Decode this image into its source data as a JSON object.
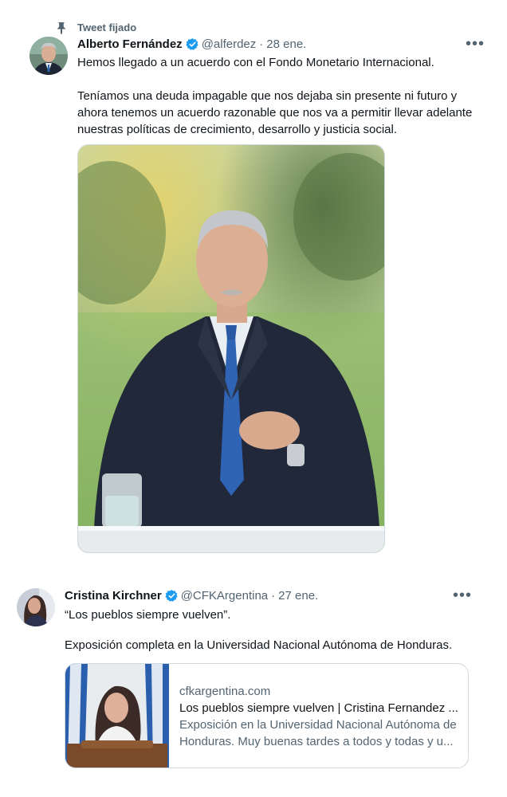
{
  "pinned": {
    "label": "Tweet fijado"
  },
  "tweets": [
    {
      "name": "Alberto Fernández",
      "handle": "@alferdez",
      "date": "28 ene.",
      "text_line1": "Hemos llegado a un acuerdo con el Fondo Monetario Internacional.",
      "text_para2": "Teníamos una deuda impagable que nos dejaba sin presente ni futuro y ahora tenemos un acuerdo razonable que nos va a permitir llevar adelante nuestras políticas de crecimiento, desarrollo y justicia social.",
      "icons": {
        "avatar": "profile-photo",
        "verified": "verified-badge-icon",
        "more": "more-icon"
      }
    },
    {
      "name": "Cristina Kirchner",
      "handle": "@CFKArgentina",
      "date": "27 ene.",
      "text_line1": "“Los pueblos siempre vuelven”.",
      "text_para2": "Exposición completa en la Universidad Nacional Autónoma de Honduras.",
      "link": {
        "domain": "cfkargentina.com",
        "title": "Los pueblos siempre vuelven | Cristina Fernandez ...",
        "description": "Exposición en la Universidad Nacional Autónoma de Honduras. Muy buenas tardes a todos y todas y u..."
      }
    }
  ],
  "separator": "·",
  "more_glyph": "•••",
  "colors": {
    "accent": "#1d9bf0",
    "secondary_text": "#536471",
    "border": "#cfd9de"
  }
}
